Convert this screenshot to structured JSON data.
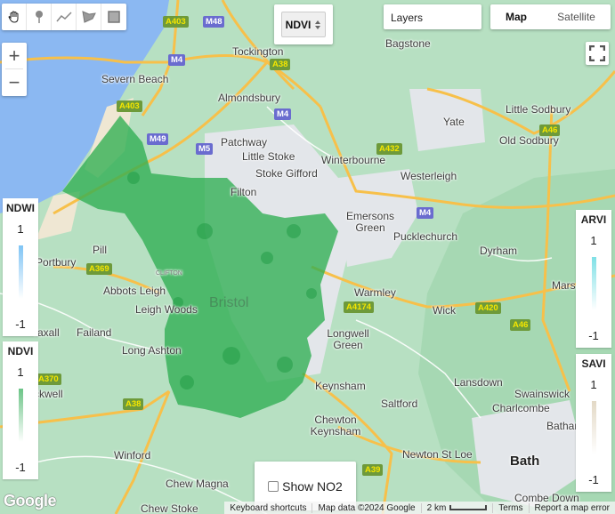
{
  "toolbar": {
    "tools": [
      {
        "name": "hand-icon",
        "label": "Pan"
      },
      {
        "name": "marker-icon",
        "label": "Add marker"
      },
      {
        "name": "line-icon",
        "label": "Draw line"
      },
      {
        "name": "polygon-icon",
        "label": "Draw shape"
      },
      {
        "name": "rectangle-icon",
        "label": "Draw rectangle"
      }
    ]
  },
  "zoom": {
    "in_label": "+",
    "out_label": "−"
  },
  "index_select": {
    "value": "NDVI",
    "icon": "updown-arrows-icon"
  },
  "layers": {
    "label": "Layers"
  },
  "map_type": {
    "map_label": "Map",
    "satellite_label": "Satellite",
    "selected": "Map"
  },
  "fullscreen": {
    "icon": "fullscreen-icon"
  },
  "legends": [
    {
      "title": "NDWI",
      "max": "1",
      "min": "-1",
      "color": "#7fc4f5"
    },
    {
      "title": "NDVI",
      "max": "1",
      "min": "-1",
      "color": "#6cc487"
    },
    {
      "title": "ARVI",
      "max": "1",
      "min": "-1",
      "color": "#7fe0e6"
    },
    {
      "title": "SAVI",
      "max": "1",
      "min": "-1",
      "color": "#e3d9c6"
    }
  ],
  "no2": {
    "label": "Show NO2",
    "checked": false
  },
  "footer": {
    "shortcuts": "Keyboard shortcuts",
    "map_data": "Map data ©2024 Google",
    "scale": "2 km",
    "terms": "Terms",
    "report": "Report a map error"
  },
  "logo": "Google",
  "places": {
    "tockington": "Tockington",
    "severn_beach": "Severn Beach",
    "almondsbury": "Almondsbury",
    "bagstone": "Bagstone",
    "patchway": "Patchway",
    "yate": "Yate",
    "little_sodbury": "Little Sodbury",
    "old_sodbury": "Old Sodbury",
    "little_stoke": "Little Stoke",
    "winterbourne": "Winterbourne",
    "stoke_gifford": "Stoke Gifford",
    "westerleigh": "Westerleigh",
    "filton": "Filton",
    "emersons_green": "Emersons Green",
    "pucklechurch": "Pucklechurch",
    "pill": "Pill",
    "portbury": "Portbury",
    "dyrham": "Dyrham",
    "abbots_leigh": "Abbots Leigh",
    "bristol": "Bristol",
    "warmley": "Warmley",
    "marsh": "Mars",
    "leigh_woods": "Leigh Woods",
    "wick": "Wick",
    "failand": "Failand",
    "wraxall": "raxall",
    "longwell_green": "Longwell Green",
    "long_ashton": "Long Ashton",
    "nailsea": "ckwell",
    "keynsham": "Keynsham",
    "lansdown": "Lansdown",
    "swainswick": "Swainswick",
    "charlcombe": "Charlcombe",
    "saltford": "Saltford",
    "chewton_keynsham": "Chewton Keynsham",
    "batheaston": "Bathar",
    "winford": "Winford",
    "newton_st_loe": "Newton St Loe",
    "bath": "Bath",
    "chew_magna": "Chew Magna",
    "chew_stoke": "Chew Stoke",
    "combe_down": "Combe Down",
    "clifton": "CLIFTON"
  },
  "road_shields": {
    "a403_top": "A403",
    "m48": "M48",
    "m4_nw": "M4",
    "a38_n": "A38",
    "a403_mid": "A403",
    "m4_almond": "M4",
    "m49": "M49",
    "m5": "M5",
    "a432": "A432",
    "a46_n": "A46",
    "m4_e": "M4",
    "a369": "A369",
    "a4174": "A4174",
    "a420": "A420",
    "a46_s": "A46",
    "a370": "A370",
    "a38_s": "A38",
    "a39": "A39"
  }
}
